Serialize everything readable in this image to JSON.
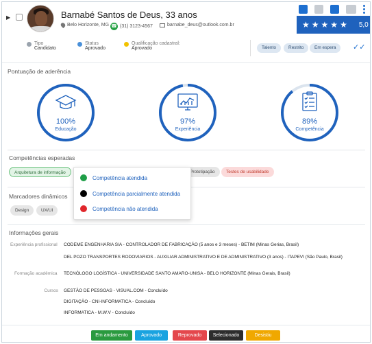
{
  "candidate": {
    "name": "Barnabé Santos de Deus, 33 anos",
    "location": "Belo Horizonte, MG",
    "phone": "(31) 3123-4567",
    "email": "barnabe_deus@outlook.com.br",
    "rating": {
      "stars": 5,
      "value": "5,0"
    }
  },
  "meta": {
    "tipo_label": "Tipo",
    "tipo_value": "Candidato",
    "status_label": "Status",
    "status_value": "Aprovado",
    "qualif_label": "Qualificação cadastral:",
    "qualif_value": "Aprovado"
  },
  "tags": [
    "Talento",
    "Restrito",
    "Em espera"
  ],
  "adherence": {
    "title": "Pontuação de aderência",
    "gauges": [
      {
        "percent": "100%",
        "label": "Educação",
        "value": 100,
        "icon": "graduation-cap-icon"
      },
      {
        "percent": "97%",
        "label": "Experiência",
        "value": 97,
        "icon": "chart-monitor-icon"
      },
      {
        "percent": "89%",
        "label": "Competência",
        "value": 89,
        "icon": "checklist-icon"
      }
    ]
  },
  "competencies": {
    "title": "Competências esperadas",
    "chips": [
      "Arquitetura de informação",
      "Prototipação",
      "Testes de usabilidade"
    ]
  },
  "legend": {
    "items": [
      {
        "label": "Competência atendida",
        "color": "#1e9e47"
      },
      {
        "label": "Competência parcialmente atendida",
        "color": "#000000"
      },
      {
        "label": "Competência não atendida",
        "color": "#e0262b"
      }
    ]
  },
  "markers": {
    "title": "Marcadores dinâmicos",
    "chips": [
      "Design",
      "UX/UI"
    ]
  },
  "info": {
    "title": "Informações gerais",
    "experience_label": "Experiência profissional",
    "experience": [
      "CODEME ENGENHARIA S/A - CONTROLADOR DE FABRICAÇÃO (5 anos e 3 meses) - BETIM (Minas Gerias, Brasil)",
      "DEL POZO TRANSPORTES RODOVIARIOS - AUXILIAR ADMINISTRATIVO E DE ADMINISTRATIVO (3 anos) - ITAPEVI (São Paulo, Brasil)"
    ],
    "education_label": "Formação acadêmica",
    "education": [
      "TECNÓLOGO LOGÍSTICA - UNIVERSIDADE SANTO AMARO-UNISA - BELO HORIZONTE (Minas Gerais, Brasil)"
    ],
    "courses_label": "Cursos",
    "courses": [
      "GESTÃO DE PESSOAS - VISUAL.COM - Concluído",
      "DIGITAÇÃO - CNI-INFORMATICA - Concluído",
      "INFORMATICA - M.W.V - Concluído"
    ]
  },
  "actions": [
    {
      "label": "Em andamento",
      "color": "#2a9a3f"
    },
    {
      "label": "Aprovado",
      "color": "#1aa3e0"
    },
    {
      "label": "Reprovado",
      "color": "#e4474c"
    },
    {
      "label": "Selecionado",
      "color": "#2d2d2d"
    },
    {
      "label": "Desistiu",
      "color": "#f0a800"
    }
  ],
  "colors": {
    "accent": "#1f62bd",
    "ring": "#1f62bd",
    "ring_track": "#dbe4ee"
  }
}
